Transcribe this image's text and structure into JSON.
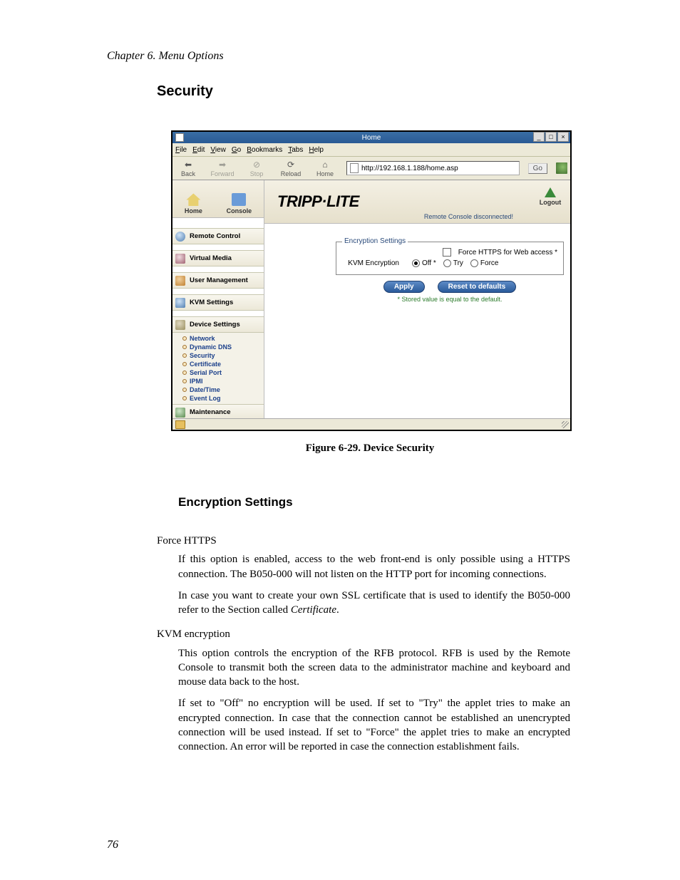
{
  "page": {
    "chapter_header": "Chapter 6. Menu Options",
    "section_title": "Security",
    "figure_caption": "Figure 6-29. Device Security",
    "subsection_title": "Encryption Settings",
    "page_number": "76"
  },
  "browser": {
    "window_title": "Home",
    "menu": {
      "file": "File",
      "edit": "Edit",
      "view": "View",
      "go": "Go",
      "bookmarks": "Bookmarks",
      "tabs": "Tabs",
      "help": "Help"
    },
    "toolbar": {
      "back": "Back",
      "forward": "Forward",
      "stop": "Stop",
      "reload": "Reload",
      "home": "Home",
      "address": "http://192.168.1.188/home.asp",
      "go": "Go"
    },
    "header": {
      "home": "Home",
      "console": "Console",
      "brand": "TRIPP·LITE",
      "status": "Remote Console disconnected!",
      "logout": "Logout"
    },
    "nav": {
      "remote_control": "Remote Control",
      "virtual_media": "Virtual Media",
      "user_management": "User Management",
      "kvm_settings": "KVM Settings",
      "device_settings": "Device Settings",
      "sub": {
        "network": "Network",
        "dynamic_dns": "Dynamic DNS",
        "security": "Security",
        "certificate": "Certificate",
        "serial_port": "Serial Port",
        "ipmi": "IPMI",
        "date_time": "Date/Time",
        "event_log": "Event Log"
      },
      "maintenance": "Maintenance"
    },
    "panel": {
      "legend": "Encryption Settings",
      "force_https_label": "Force HTTPS for Web access *",
      "kvm_enc_label": "KVM Encryption",
      "opt_off": "Off *",
      "opt_try": "Try",
      "opt_force": "Force",
      "apply": "Apply",
      "reset": "Reset to defaults",
      "footnote": "* Stored value is equal to the default."
    }
  },
  "text": {
    "term1": "Force HTTPS",
    "def1a": "If this option is enabled, access to the web front-end is only possible using a HTTPS connection. The B050-000 will not listen on the HTTP port for incoming connections.",
    "def1b_pre": "In case you want to create your own SSL certificate that is used to identify the B050-000 refer to the Section called ",
    "def1b_ital": "Certificate",
    "def1b_post": ".",
    "term2": "KVM encryption",
    "def2a": "This option controls the encryption of the RFB protocol. RFB is used by the Remote Console to transmit both the screen data to the administrator machine and keyboard and mouse data back to the host.",
    "def2b": "If set to \"Off\" no encryption will be used. If set to \"Try\" the applet tries to make an encrypted connection. In case that the connection cannot be established an unencrypted connection will be used instead. If set to \"Force\" the applet tries to make an encrypted connection. An error will be reported in case the connection establishment fails."
  }
}
